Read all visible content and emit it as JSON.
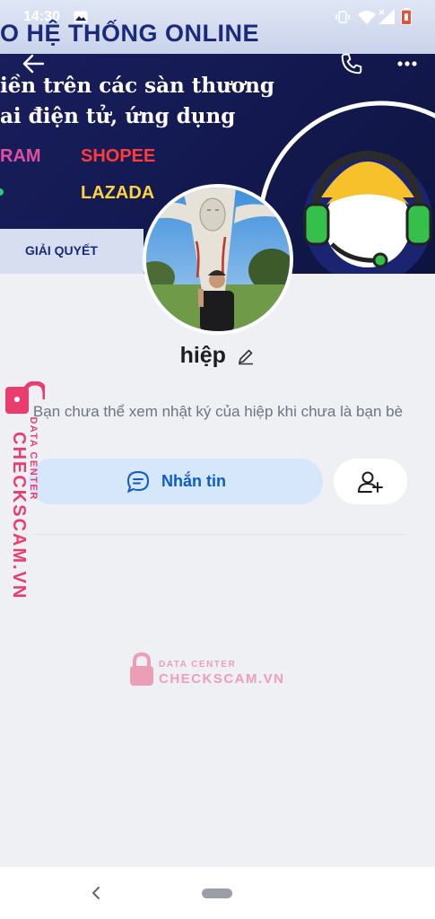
{
  "status_bar": {
    "time": "14:30"
  },
  "cover": {
    "headline": "O HỆ THỐNG ONLINE",
    "line1": "iền trên các sàn thương",
    "line2": "ai điện tử, ứng dụng",
    "brand_left": "RAM",
    "brand_shopee": "SHOPEE",
    "brand_lazada": "LAZADA",
    "resolve_label": "GIẢI QUYẾT"
  },
  "profile": {
    "name": "hiệp",
    "notice": "Bạn chưa thể xem nhật ký của hiệp khi chưa là bạn bè"
  },
  "actions": {
    "message_label": "Nhắn tin"
  },
  "watermark": {
    "tag": "DATA CENTER",
    "site": "CHECKSCAM.VN"
  },
  "colors": {
    "accent": "#0b5cc9",
    "message_bg": "#d6e6fb",
    "page_bg": "#eef0f4",
    "watermark": "#ea3d6f"
  }
}
